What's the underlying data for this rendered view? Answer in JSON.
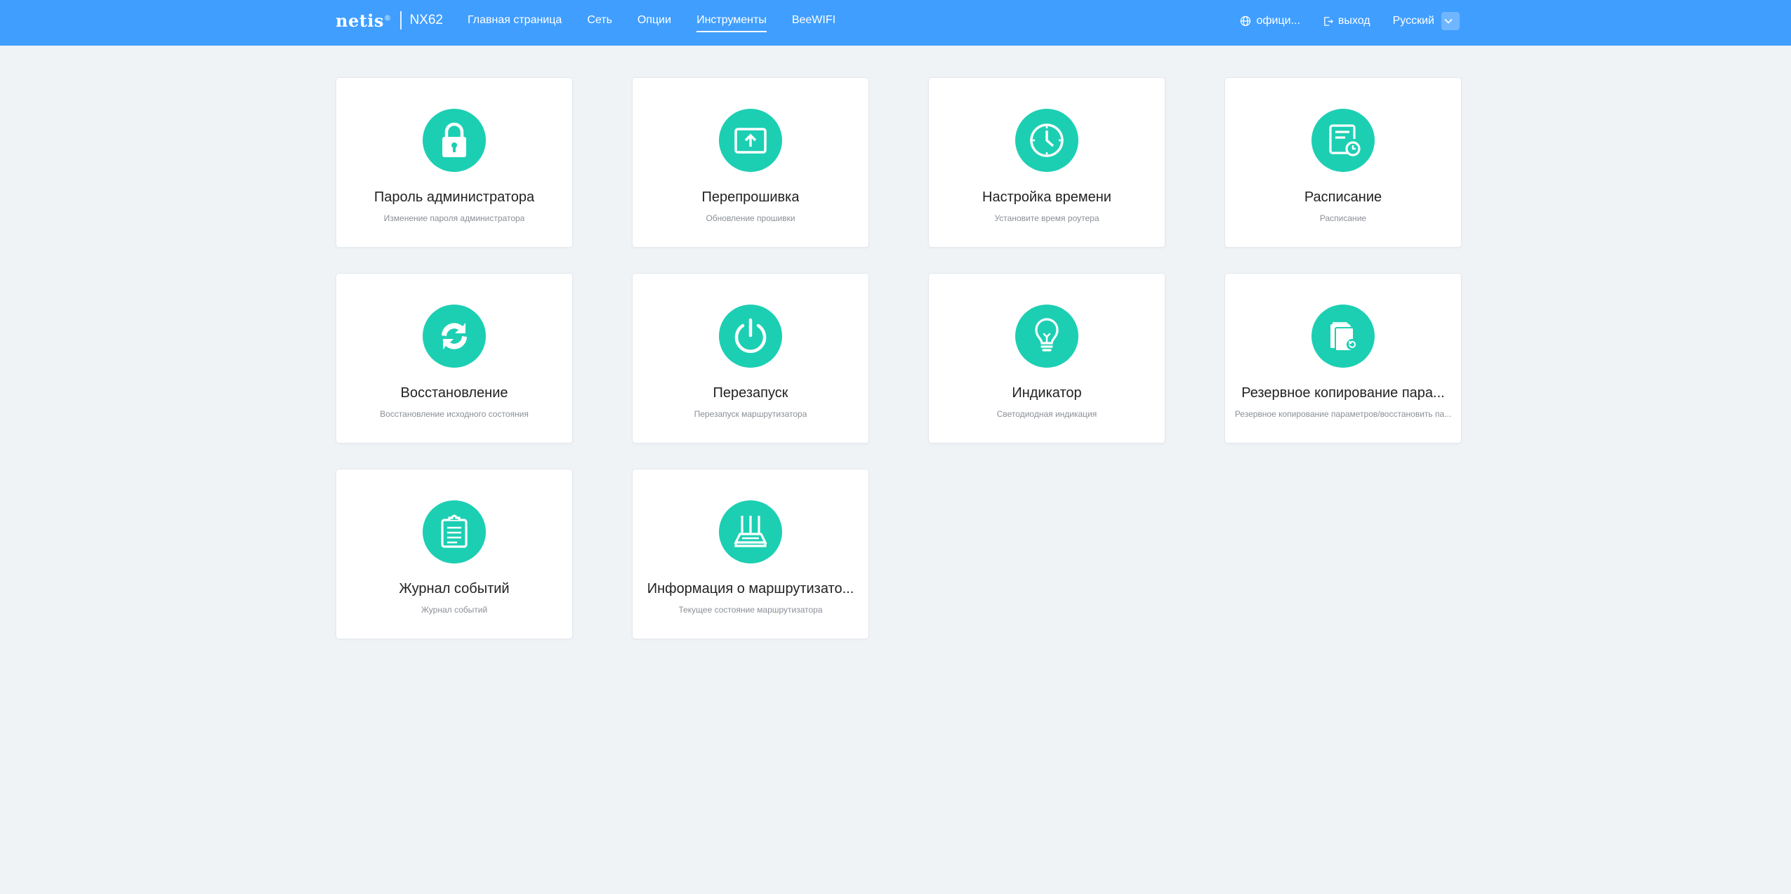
{
  "header": {
    "brand_logo": "netis",
    "brand_reg": "®",
    "model": "NX62",
    "nav": [
      {
        "label": "Главная страница"
      },
      {
        "label": "Сеть"
      },
      {
        "label": "Опции"
      },
      {
        "label": "Инструменты",
        "active": true
      },
      {
        "label": "BeeWIFI"
      }
    ],
    "official_label": "офици...",
    "logout_label": "выход",
    "language": "Русский",
    "icons": {
      "official": "globe-icon",
      "logout": "logout-icon",
      "language": "chevron-down-icon"
    }
  },
  "colors": {
    "header": "#409eff",
    "accent": "#1ccfb3",
    "background": "#eff3f6"
  },
  "tools": [
    {
      "icon": "lock-icon",
      "title": "Пароль администратора",
      "desc": "Изменение пароля администратора"
    },
    {
      "icon": "firmware-upload-icon",
      "title": "Перепрошивка",
      "desc": "Обновление прошивки"
    },
    {
      "icon": "clock-icon",
      "title": "Настройка времени",
      "desc": "Установите время роутера"
    },
    {
      "icon": "schedule-icon",
      "title": "Расписание",
      "desc": "Расписание"
    },
    {
      "icon": "restore-arrows-icon",
      "title": "Восстановление",
      "desc": "Восстановление исходного состояния"
    },
    {
      "icon": "power-icon",
      "title": "Перезапуск",
      "desc": "Перезапуск маршрутизатора"
    },
    {
      "icon": "lightbulb-icon",
      "title": "Индикатор",
      "desc": "Светодиодная индикация"
    },
    {
      "icon": "backup-icon",
      "title": "Резервное копирование пара...",
      "desc": "Резервное копирование параметров/восстановить па..."
    },
    {
      "icon": "event-log-icon",
      "title": "Журнал событий",
      "desc": "Журнал событий"
    },
    {
      "icon": "router-icon",
      "title": "Информация о маршрутизато...",
      "desc": "Текущее состояние маршрутизатора"
    }
  ]
}
